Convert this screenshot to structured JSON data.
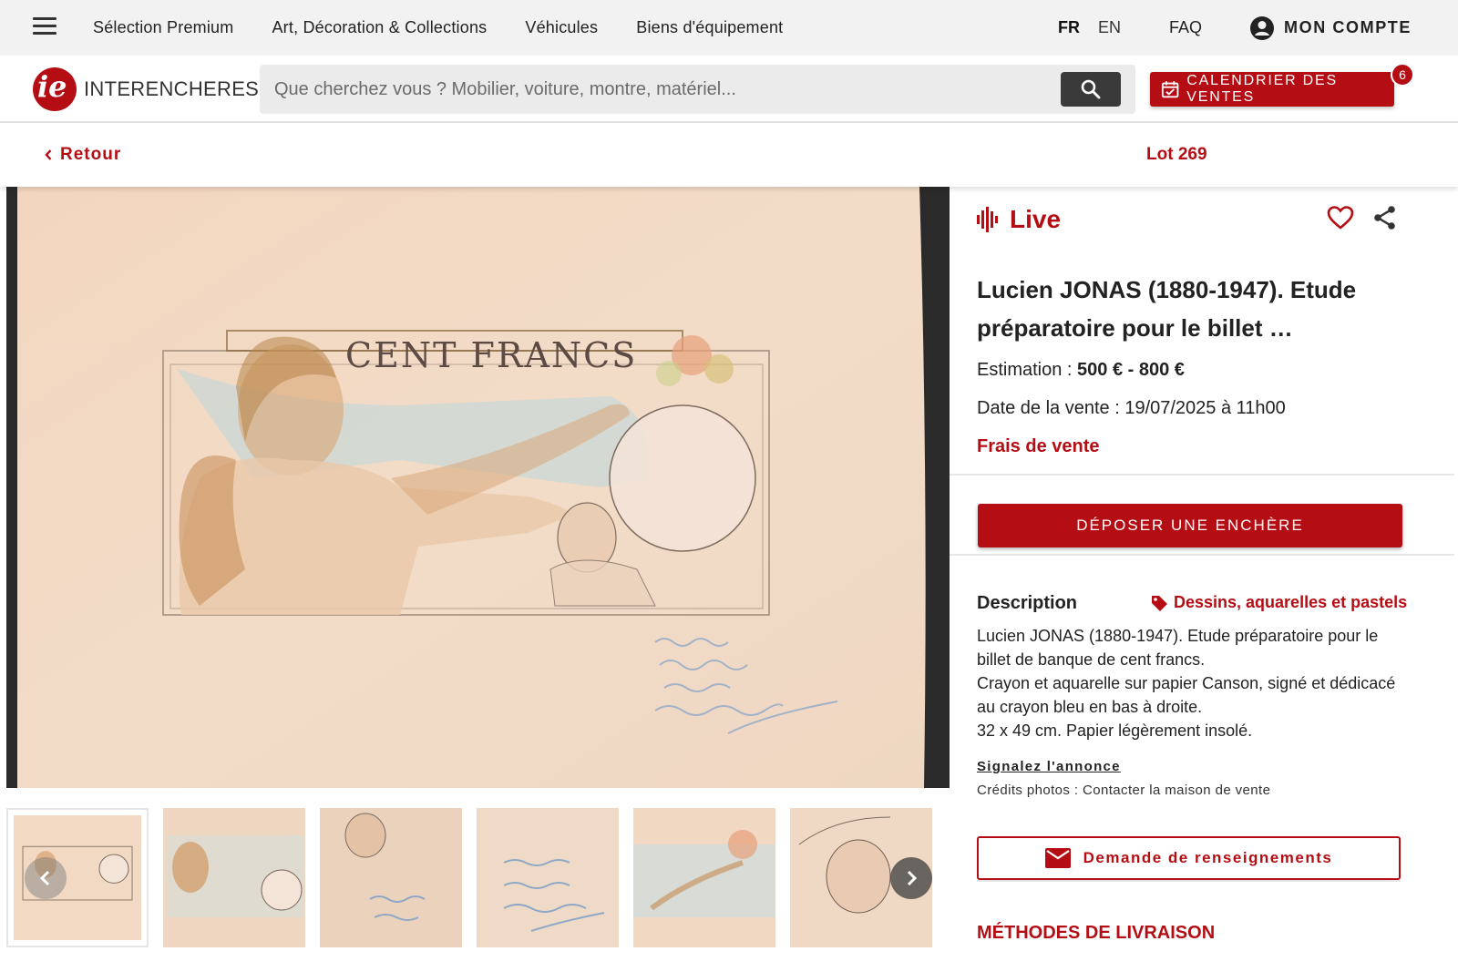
{
  "topnav": {
    "links": [
      "Sélection Premium",
      "Art, Décoration & Collections",
      "Véhicules",
      "Biens d'équipement"
    ],
    "lang_fr": "FR",
    "lang_en": "EN",
    "faq": "FAQ",
    "account": "MON COMPTE"
  },
  "header": {
    "logo_mark": "ie",
    "logo_text": "INTERENCHERES",
    "search_placeholder": "Que cherchez vous ? Mobilier, voiture, montre, matériel...",
    "calendar_label": "CALENDRIER DES VENTES",
    "calendar_badge": "6"
  },
  "backbar": {
    "back_label": "Retour",
    "lot_label": "Lot 269"
  },
  "main_image": {
    "inscription": "CENT FRANCS"
  },
  "panel": {
    "live_label": "Live",
    "title": "Lucien JONAS (1880-1947). Etude préparatoire pour le billet …",
    "estimation_label": "Estimation : ",
    "estimation_value": "500 € - 800 €",
    "date_label": "Date de la vente : ",
    "date_value": "19/07/2025 à 11h00",
    "fees_label": "Frais de vente",
    "bid_button": "DÉPOSER UNE ENCHÈRE",
    "description_heading": "Description",
    "category": "Dessins, aquarelles et pastels",
    "description_lines": [
      "Lucien JONAS (1880-1947). Etude préparatoire pour le billet de banque de cent francs.",
      "Crayon et aquarelle sur papier Canson, signé et dédicacé au crayon bleu en bas à droite.",
      "32 x 49 cm. Papier légèrement insolé."
    ],
    "report_link": "Signalez l'annonce",
    "photo_credits": "Crédits photos : Contacter la maison de vente",
    "info_button": "Demande de renseignements",
    "delivery_heading": "MÉTHODES DE LIVRAISON"
  },
  "colors": {
    "brand_red": "#b50d14",
    "nav_bg": "#f2f2f2",
    "paper": "#f1d9c3"
  },
  "icons": [
    "menu-icon",
    "account-icon",
    "search-icon",
    "calendar-icon",
    "chevron-left-icon",
    "live-icon",
    "heart-icon",
    "share-icon",
    "tag-icon",
    "mail-icon",
    "arrow-left-icon",
    "arrow-right-icon"
  ]
}
